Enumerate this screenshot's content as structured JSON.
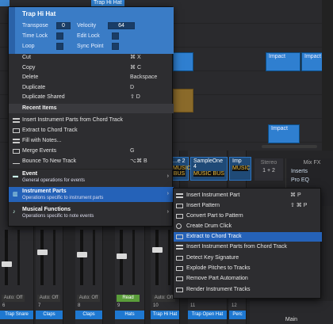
{
  "background": {
    "top_clips": [
      "Trap Hi Hat"
    ],
    "impact_clips": [
      "Impact",
      "Impact",
      "Impact"
    ],
    "channel_headers": [
      {
        "name": "...e 2",
        "bus": "MUSIC BUS"
      },
      {
        "name": "SampleOne 4",
        "bus": "MUSIC BUS"
      },
      {
        "name": "Imp",
        "bus": "MUSIC"
      }
    ],
    "stereo": {
      "label": "Stereo",
      "value": "1 + 2"
    },
    "mixfx": {
      "title": "Mix FX",
      "inserts": "Inserts",
      "plugin": "Pro EQ"
    },
    "mixer_channels": [
      {
        "num": "6",
        "auto": "Auto: Off",
        "name": "Trap Snare"
      },
      {
        "num": "7",
        "auto": "Auto: Off",
        "name": "Claps"
      },
      {
        "num": "8",
        "auto": "Auto: Off",
        "name": "Claps"
      },
      {
        "num": "9",
        "auto": "Read",
        "name": "Hats"
      },
      {
        "num": "10",
        "auto": "Auto: Off",
        "name": "Trap Hi Hat"
      },
      {
        "num": "11",
        "auto": "Auto: Off",
        "name": "Trap Open Hat"
      },
      {
        "num": "12",
        "auto": "Auto: Off",
        "name": "Perc"
      }
    ],
    "main_label": "Main"
  },
  "menu": {
    "header": {
      "title": "Trap Hi Hat",
      "transpose_label": "Transpose",
      "transpose_value": "0",
      "velocity_label": "Velocity",
      "velocity_value": "64",
      "timelock_label": "Time Lock",
      "editlock_label": "Edit Lock",
      "loop_label": "Loop",
      "syncpoint_label": "Sync Point"
    },
    "items": [
      {
        "label": "Cut",
        "shortcut": "⌘ X"
      },
      {
        "label": "Copy",
        "shortcut": "⌘ C"
      },
      {
        "label": "Delete",
        "shortcut": "Backspace"
      },
      {
        "label": "Duplicate",
        "shortcut": "D"
      },
      {
        "label": "Duplicate Shared",
        "shortcut": "⇧ D"
      }
    ],
    "recent_header": "Recent Items",
    "recent": [
      {
        "label": "Insert Instrument Parts from Chord Track",
        "shortcut": ""
      },
      {
        "label": "Extract to Chord Track",
        "shortcut": ""
      },
      {
        "label": "Fill with Notes...",
        "shortcut": ""
      },
      {
        "label": "Merge Events",
        "shortcut": "G"
      },
      {
        "label": "Bounce To New Track",
        "shortcut": "⌥⌘ B"
      }
    ],
    "groups": [
      {
        "title": "Event",
        "desc": "General operations for events"
      },
      {
        "title": "Instrument Parts",
        "desc": "Operations specific to instrument parts"
      },
      {
        "title": "Musical Functions",
        "desc": "Operations specific to note events"
      }
    ]
  },
  "submenu": {
    "items": [
      {
        "label": "Insert Instrument Part",
        "shortcut": "⌘ P"
      },
      {
        "label": "Insert Pattern",
        "shortcut": "⇧ ⌘ P"
      },
      {
        "label": "Convert Part to Pattern",
        "shortcut": ""
      },
      {
        "label": "Create Drum Click",
        "shortcut": ""
      },
      {
        "label": "Extract to Chord Track",
        "shortcut": ""
      },
      {
        "label": "Insert Instrument Parts from Chord Track",
        "shortcut": ""
      },
      {
        "label": "Detect Key Signature",
        "shortcut": ""
      },
      {
        "label": "Explode Pitches to Tracks",
        "shortcut": ""
      },
      {
        "label": "Remove Part Automation",
        "shortcut": ""
      },
      {
        "label": "Render Instrument Tracks",
        "shortcut": ""
      }
    ]
  }
}
